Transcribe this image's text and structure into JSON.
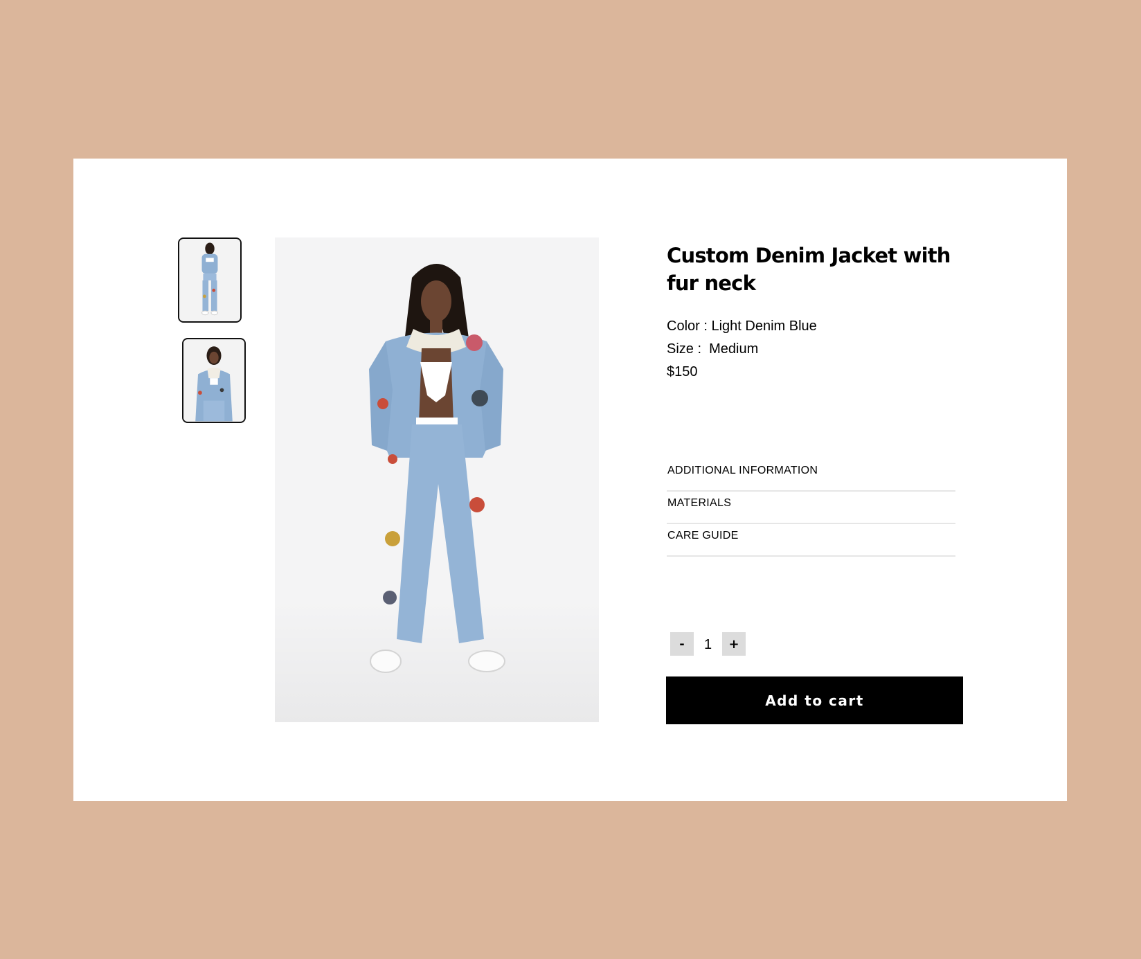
{
  "product": {
    "title": "Custom Denim Jacket with fur neck",
    "color_line": "Color : Light Denim Blue",
    "size_line": "Size :  Medium",
    "price": "$150"
  },
  "gallery": {
    "thumbnails": [
      "full-length front view",
      "jacket close-up view"
    ],
    "main_image": "model wearing denim jacket and jeans"
  },
  "accordion": {
    "items": [
      "ADDITIONAL INFORMATION",
      "MATERIALS",
      "CARE GUIDE"
    ]
  },
  "quantity": {
    "minus_label": "-",
    "value": "1",
    "plus_label": "+"
  },
  "cart": {
    "add_label": "Add to cart"
  },
  "colors": {
    "page_background": "#dbb69b",
    "card_background": "#ffffff",
    "button_background": "#000000",
    "stepper_background": "#dcdcdc",
    "denim": "#8fb0d3"
  }
}
